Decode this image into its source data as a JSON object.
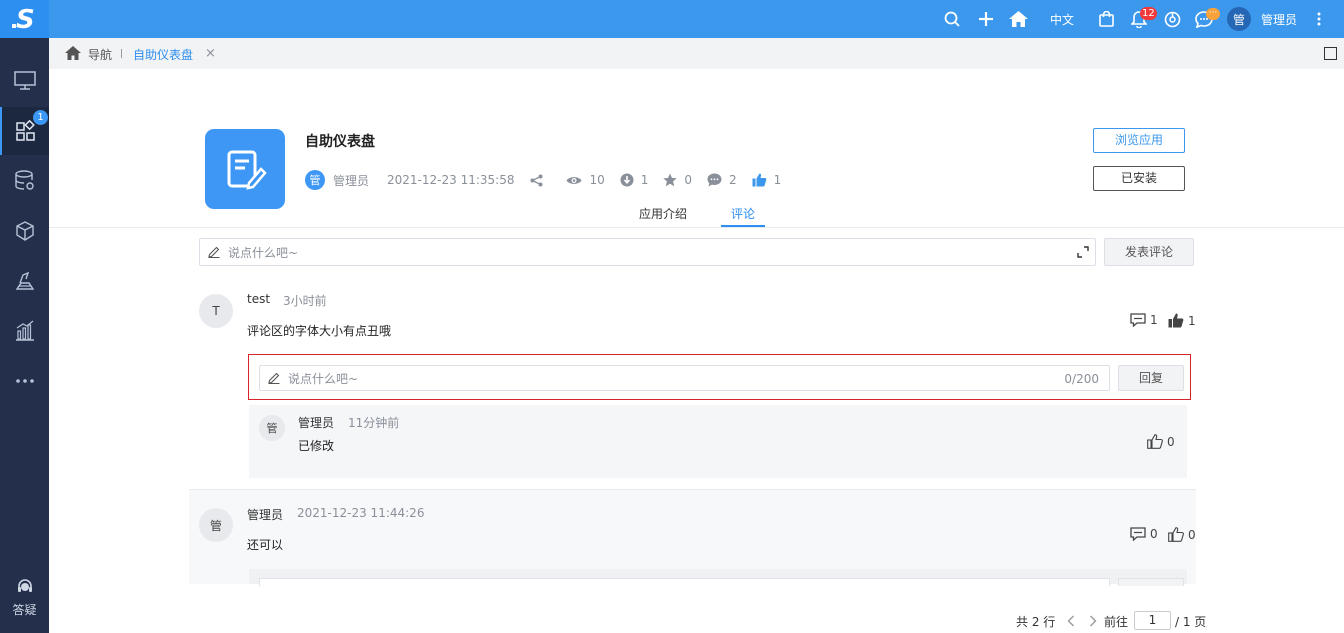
{
  "colors": {
    "topbar": "#3c98ec",
    "sidebar": "#232f4b",
    "accent": "#2d8ff0",
    "highlight_border": "#d9232b"
  },
  "sidebar": {
    "items": [
      {
        "icon": "monitor-icon"
      },
      {
        "icon": "apps-icon",
        "badge": "1",
        "active": true
      },
      {
        "icon": "database-settings-icon"
      },
      {
        "icon": "cube-icon"
      },
      {
        "icon": "layers-icon"
      },
      {
        "icon": "bar-chart-icon"
      },
      {
        "icon": "more-icon"
      }
    ],
    "help_label": "答疑"
  },
  "topbar": {
    "language": "中文",
    "notification_badge": "12",
    "message_badge": "···",
    "avatar_text": "管",
    "user_name": "管理员"
  },
  "breadcrumb": {
    "nav_label": "导航",
    "active_tab": "自助仪表盘",
    "close_symbol": "×"
  },
  "app": {
    "title": "自助仪表盘",
    "author_avatar": "管",
    "author": "管理员",
    "created": "2021-12-23 11:35:58",
    "views": "10",
    "downloads": "1",
    "favorites": "0",
    "comments": "2",
    "likes": "1",
    "browse_button": "浏览应用",
    "installed_button": "已安装"
  },
  "tabs": {
    "intro": "应用介绍",
    "comments": "评论",
    "active": "comments"
  },
  "comment_input": {
    "placeholder": "说点什么吧~",
    "post_button": "发表评论"
  },
  "comments": [
    {
      "avatar": "T",
      "user": "test",
      "time": "3小时前",
      "text": "评论区的字体大小有点丑哦",
      "reply_count": "1",
      "like_count": "1",
      "reply_input": {
        "placeholder": "说点什么吧~",
        "counter": "0/200",
        "button": "回复"
      },
      "replies": [
        {
          "avatar": "管",
          "user": "管理员",
          "time": "11分钟前",
          "text": "已修改",
          "like_count": "0"
        }
      ]
    },
    {
      "avatar": "管",
      "user": "管理员",
      "time": "2021-12-23 11:44:26",
      "text": "还可以",
      "reply_count": "0",
      "like_count": "0"
    }
  ],
  "pagination": {
    "total": "共 2 行",
    "goto_label": "前往",
    "current_page": "1",
    "total_pages": "/ 1 页"
  }
}
